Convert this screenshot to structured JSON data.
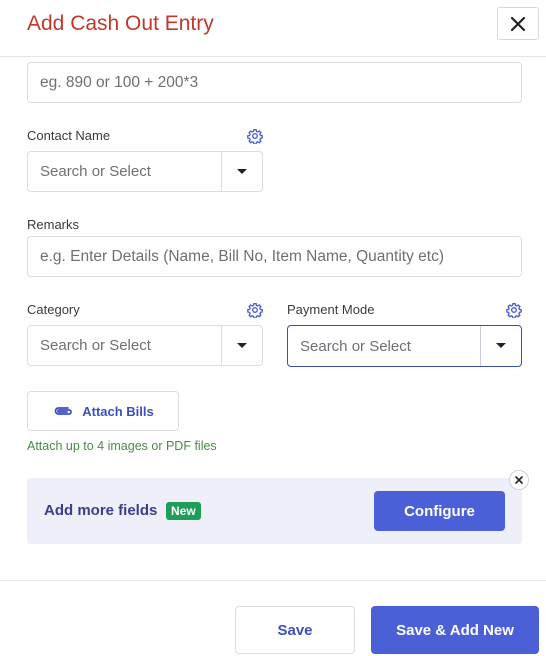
{
  "dialog": {
    "title": "Add Cash Out Entry"
  },
  "amount": {
    "placeholder": "eg. 890 or 100 + 200*3"
  },
  "contact": {
    "label": "Contact Name",
    "placeholder": "Search or Select"
  },
  "remarks": {
    "label": "Remarks",
    "placeholder": "e.g. Enter Details (Name, Bill No, Item Name, Quantity etc)"
  },
  "category": {
    "label": "Category",
    "placeholder": "Search or Select"
  },
  "payment_mode": {
    "label": "Payment Mode",
    "placeholder": "Search or Select"
  },
  "attach": {
    "button_label": "Attach Bills",
    "hint": "Attach up to 4 images or PDF files"
  },
  "more_fields": {
    "text": "Add more fields",
    "badge": "New",
    "configure_label": "Configure"
  },
  "footer": {
    "save_label": "Save",
    "save_new_label": "Save & Add New"
  },
  "colors": {
    "title": "#c0392b",
    "primary": "#4b5fd6",
    "badge": "#1e9e5a",
    "hint": "#4a8a4a"
  },
  "icons": {
    "close": "close-icon",
    "gear": "gear-icon",
    "dropdown": "chevron-down-icon",
    "attach": "paperclip-icon"
  }
}
